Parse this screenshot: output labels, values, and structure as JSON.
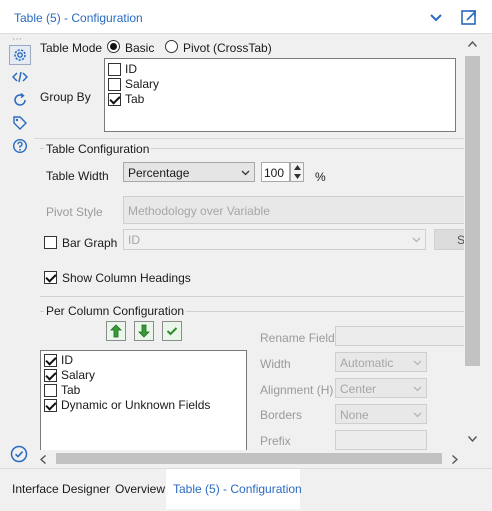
{
  "window": {
    "title": "Table (5) - Configuration"
  },
  "table_mode": {
    "label": "Table Mode",
    "options": [
      "Basic",
      "Pivot (CrossTab)"
    ],
    "selected": "Basic"
  },
  "group_by": {
    "label": "Group By",
    "items": [
      {
        "label": "ID",
        "checked": false
      },
      {
        "label": "Salary",
        "checked": false
      },
      {
        "label": "Tab",
        "checked": true
      }
    ]
  },
  "table_config": {
    "title": "Table Configuration",
    "width_label": "Table Width",
    "width_mode": "Percentage",
    "width_value": "100",
    "width_unit": "%",
    "pivot_style_label": "Pivot Style",
    "pivot_style_value": "Methodology over Variable",
    "bar_graph_label": "Bar Graph",
    "bar_graph_checked": false,
    "bar_graph_field": "ID",
    "bar_graph_button": "S",
    "show_headings_label": "Show Column Headings",
    "show_headings_checked": true
  },
  "per_column": {
    "title": "Per Column Configuration",
    "fields": [
      {
        "label": "ID",
        "checked": true
      },
      {
        "label": "Salary",
        "checked": true
      },
      {
        "label": "Tab",
        "checked": false
      },
      {
        "label": "Dynamic or Unknown Fields",
        "checked": true
      }
    ],
    "rename_label": "Rename Field",
    "width_label": "Width",
    "width_value": "Automatic",
    "alignment_label": "Alignment (H)",
    "alignment_value": "Center",
    "borders_label": "Borders",
    "borders_value": "None",
    "prefix_label": "Prefix"
  },
  "tabs": [
    {
      "label": "Interface Designer",
      "active": false
    },
    {
      "label": "Overview",
      "active": false
    },
    {
      "label": "Table (5) - Configuration",
      "active": true
    }
  ],
  "sidebar_icons": [
    "gear-icon",
    "code-icon",
    "rotate-icon",
    "tag-icon",
    "help-icon",
    "check-circle-icon"
  ],
  "colors": {
    "accent": "#2a6ac0",
    "arrow_green": "#3a9a3a"
  }
}
